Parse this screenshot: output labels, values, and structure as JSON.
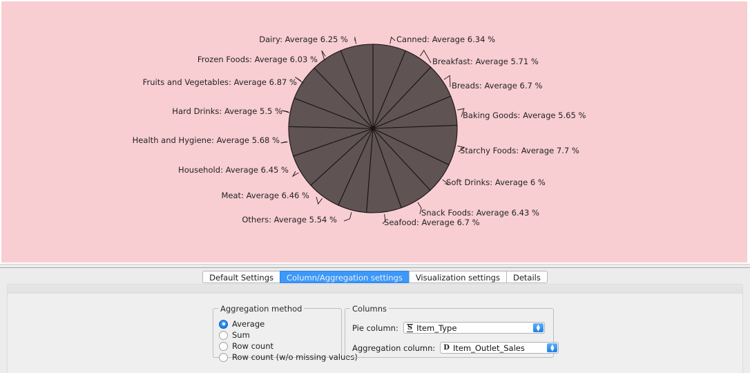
{
  "chart_data": {
    "type": "pie",
    "title": "",
    "value_unit": "%",
    "aggregation": "Average",
    "legend_position": "callout-labels",
    "slice_fill": "#5f5354",
    "slice_stroke": "#1b1416",
    "background": "#f8ced2",
    "categories": [
      "Canned",
      "Breakfast",
      "Breads",
      "Baking Goods",
      "Starchy Foods",
      "Soft Drinks",
      "Snack Foods",
      "Seafood",
      "Others",
      "Meat",
      "Household",
      "Health and Hygiene",
      "Hard Drinks",
      "Fruits and Vegetables",
      "Frozen Foods",
      "Dairy"
    ],
    "values": [
      6.34,
      5.71,
      6.7,
      5.65,
      7.7,
      6,
      6.43,
      6.7,
      5.54,
      6.46,
      6.45,
      5.68,
      5.5,
      6.87,
      6.03,
      6.25
    ],
    "labels": [
      "Canned: Average 6.34 %",
      "Breakfast: Average 5.71 %",
      "Breads: Average 6.7 %",
      "Baking Goods: Average 5.65 %",
      "Starchy Foods: Average 7.7 %",
      "Soft Drinks: Average 6 %",
      "Snack Foods: Average 6.43 %",
      "Seafood: Average 6.7 %",
      "Others: Average 5.54 %",
      "Meat: Average 6.46 %",
      "Household: Average 6.45 %",
      "Health and Hygiene: Average 5.68 %",
      "Hard Drinks: Average 5.5 %",
      "Fruits and Vegetables: Average 6.87 %",
      "Frozen Foods: Average 6.03 %",
      "Dairy: Average 6.25 %"
    ]
  },
  "tabs": [
    {
      "label": "Default Settings",
      "active": false
    },
    {
      "label": "Column/Aggregation settings",
      "active": true
    },
    {
      "label": "Visualization settings",
      "active": false
    },
    {
      "label": "Details",
      "active": false
    }
  ],
  "aggregation_group": {
    "title": "Aggregation method",
    "options": [
      {
        "label": "Average",
        "selected": true
      },
      {
        "label": "Sum",
        "selected": false
      },
      {
        "label": "Row count",
        "selected": false
      },
      {
        "label": "Row count (w/o missing values)",
        "selected": false
      }
    ]
  },
  "columns_group": {
    "title": "Columns",
    "pie_column": {
      "label": "Pie column:",
      "type_icon": "S",
      "value": "Item_Type"
    },
    "aggregation_column": {
      "label": "Aggregation column:",
      "type_icon": "D",
      "value": "Item_Outlet_Sales"
    }
  }
}
